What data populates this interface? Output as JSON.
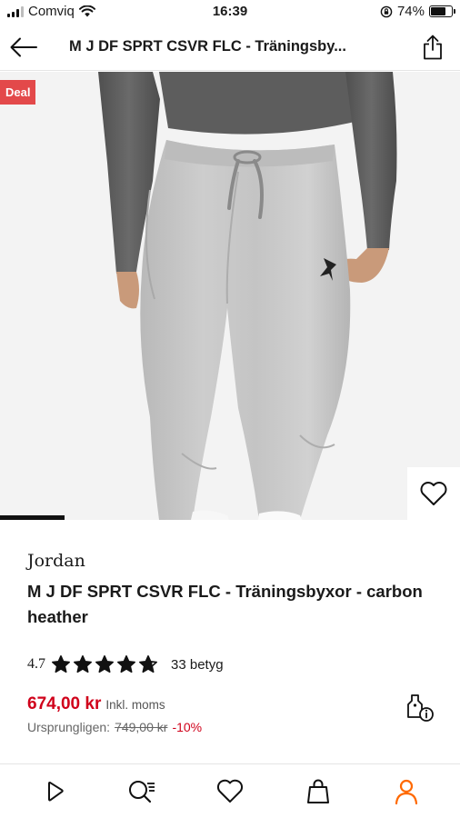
{
  "status_bar": {
    "carrier": "Comviq",
    "time": "16:39",
    "battery": "74%",
    "battery_level": 0.74
  },
  "header": {
    "title": "M J DF SPRT CSVR FLC  - Träningsby..."
  },
  "gallery": {
    "deal_badge": "Deal",
    "image_icon": "product-photo-grey-sweatpants",
    "progress": 0.14
  },
  "product": {
    "brand": "Jordan",
    "name": "M J DF SPRT CSVR FLC  - Träningsbyxor - carbon heather",
    "rating": "4.7",
    "rating_stars": 4.7,
    "rating_count": "33 betyg",
    "price": "674,00 kr",
    "vat_note": "Inkl. moms",
    "original_label": "Ursprungligen:",
    "original_price": "749,00 kr",
    "discount": "-10%"
  },
  "colors": {
    "accent": "#ff6900",
    "price_red": "#d0021b",
    "deal_red": "#e3494a"
  },
  "bottom_nav": [
    {
      "icon": "play-icon"
    },
    {
      "icon": "search-list-icon"
    },
    {
      "icon": "heart-icon"
    },
    {
      "icon": "bag-icon"
    },
    {
      "icon": "user-icon",
      "active": true
    }
  ]
}
